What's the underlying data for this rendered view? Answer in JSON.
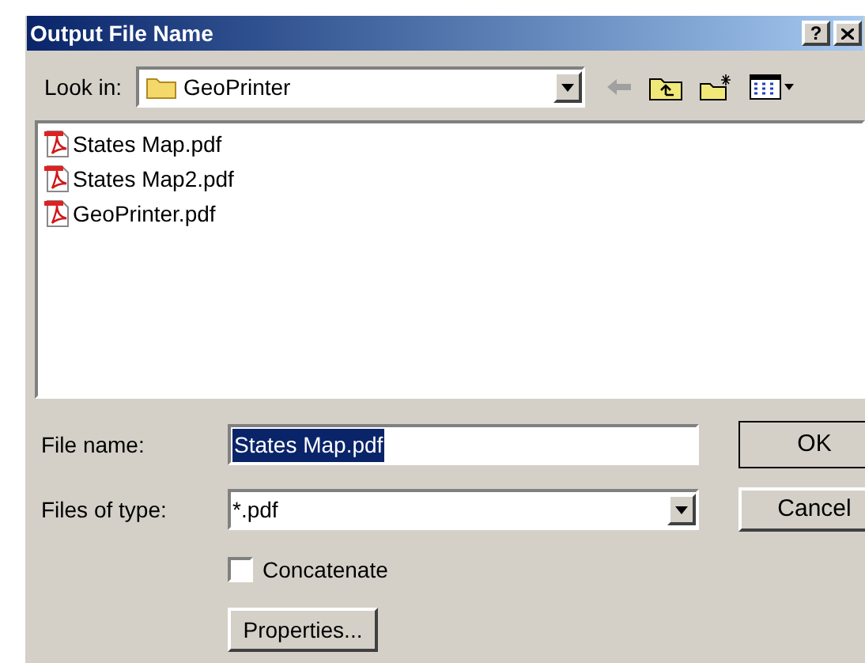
{
  "window": {
    "title": "Output File Name",
    "help_button": "?"
  },
  "look_in": {
    "label": "Look in:",
    "value": "GeoPrinter"
  },
  "files": [
    {
      "name": "States Map.pdf"
    },
    {
      "name": "States Map2.pdf"
    },
    {
      "name": "GeoPrinter.pdf"
    }
  ],
  "file_name": {
    "label": "File name:",
    "value": "States Map.pdf",
    "selected": true
  },
  "files_of_type": {
    "label": "Files of type:",
    "value": "*.pdf"
  },
  "concatenate": {
    "label": "Concatenate",
    "checked": false
  },
  "buttons": {
    "ok": "OK",
    "cancel": "Cancel",
    "properties": "Properties..."
  }
}
